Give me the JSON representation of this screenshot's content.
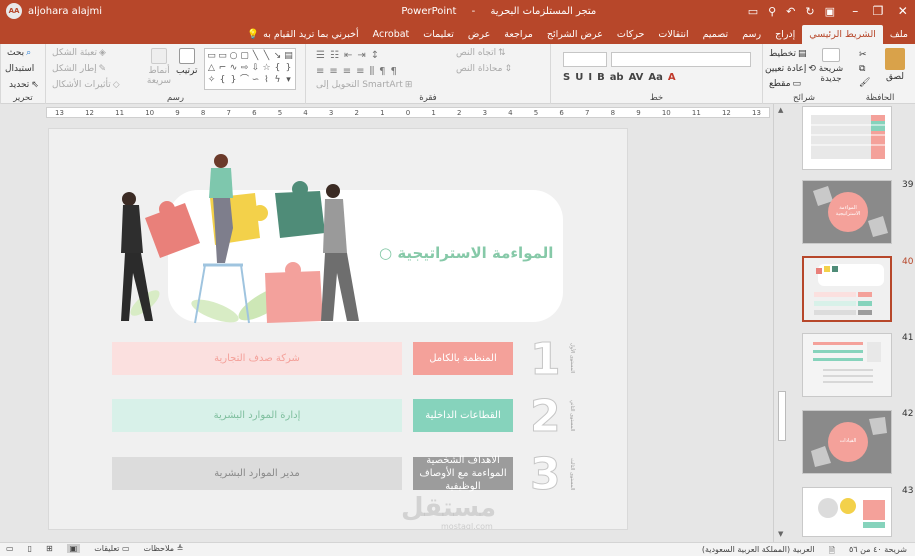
{
  "window": {
    "user_name": "aljohara alajmi",
    "avatar_initials": "AA",
    "app_name": "PowerPoint",
    "doc_title": "متجر المستلزمات البحرية"
  },
  "tabs": [
    {
      "label": "ملف"
    },
    {
      "label": "الشريط الرئيسي",
      "active": true
    },
    {
      "label": "إدراج"
    },
    {
      "label": "رسم"
    },
    {
      "label": "تصميم"
    },
    {
      "label": "انتقالات"
    },
    {
      "label": "حركات"
    },
    {
      "label": "عرض الشرائح"
    },
    {
      "label": "مراجعة"
    },
    {
      "label": "عرض"
    },
    {
      "label": "تعليمات"
    },
    {
      "label": "Acrobat"
    }
  ],
  "tell_me": "أخبرني بما تريد القيام به",
  "ribbon": {
    "clipboard": {
      "label": "الحافظة",
      "paste": "لصق",
      "cut": "قص",
      "copy": "نسخ"
    },
    "slides": {
      "label": "شرائح",
      "new_slide": "شريحة جديدة",
      "layout": "تخطيط",
      "reset": "إعادة تعيين",
      "section": "مقطع"
    },
    "font": {
      "label": "خط",
      "buttons": [
        "S",
        "U",
        "I",
        "B",
        "ab",
        "AV",
        "Aa",
        "A"
      ]
    },
    "paragraph": {
      "label": "فقرة",
      "text_direction": "اتجاه النص",
      "align_text": "محاذاة النص",
      "convert_smartart": "التحويل إلى SmartArt"
    },
    "drawing": {
      "label": "رسم",
      "arrange": "ترتيب",
      "quick_styles": "أنماط سريعة",
      "shape_fill": "تعبئة الشكل",
      "shape_outline": "إطار الشكل",
      "shape_effects": "تأثيرات الأشكال"
    },
    "editing": {
      "label": "تحرير",
      "find": "بحث",
      "replace": "استبدال",
      "select": "تحديد"
    }
  },
  "ruler": [
    "13",
    "12",
    "11",
    "10",
    "9",
    "8",
    "7",
    "6",
    "5",
    "4",
    "3",
    "2",
    "1",
    "0",
    "1",
    "2",
    "3",
    "4",
    "5",
    "6",
    "7",
    "8",
    "9",
    "10",
    "11",
    "12",
    "13"
  ],
  "slide": {
    "title": "المواءمة الاستراتيجية",
    "title_bullet": "○",
    "rows": [
      {
        "num": "1",
        "level": "المستوى الأول",
        "label": "المنظمة بالكامل",
        "field": "شركة صدف التجارية",
        "color": "#f4a19a",
        "field_bg": "#fbe0df",
        "field_color": "#f4a19a"
      },
      {
        "num": "2",
        "level": "المستوى الثاني",
        "label": "القطاعات الداخلية",
        "field": "إدارة الموارد البشرية",
        "color": "#86d3bc",
        "field_bg": "#d8f1e9",
        "field_color": "#7fbf9e"
      },
      {
        "num": "3",
        "level": "المستوى الثالث",
        "label": "الاهداف الشخصية المواءمة مع الأوصاف الوظيفية",
        "field": "مدير الموارد البشرية",
        "color": "#9c9c9c",
        "field_bg": "#dcdcdc",
        "field_color": "#8a8a8a"
      }
    ],
    "watermark": "مستقل",
    "watermark_sub": "mostaql.com"
  },
  "thumbnails": [
    {
      "num": "",
      "kind": "table"
    },
    {
      "num": "39",
      "kind": "circle"
    },
    {
      "num": "40",
      "kind": "current",
      "active": true
    },
    {
      "num": "41",
      "kind": "list"
    },
    {
      "num": "42",
      "kind": "circle2"
    },
    {
      "num": "43",
      "kind": "people"
    }
  ],
  "thumb_circle_text": "المواءمة الاستراتيجية",
  "thumb_circle2_text": "القيادات",
  "status": {
    "slide_of": "شريحة ٤٠ من ٥٦",
    "language": "العربية (المملكة العربية السعودية)",
    "notes": "ملاحظات",
    "comments": "تعليقات"
  },
  "colors": {
    "accent": "#b7472a",
    "pink": "#f4a19a",
    "mint": "#86d3bc",
    "gray": "#9c9c9c",
    "title": "#86c9a8"
  }
}
